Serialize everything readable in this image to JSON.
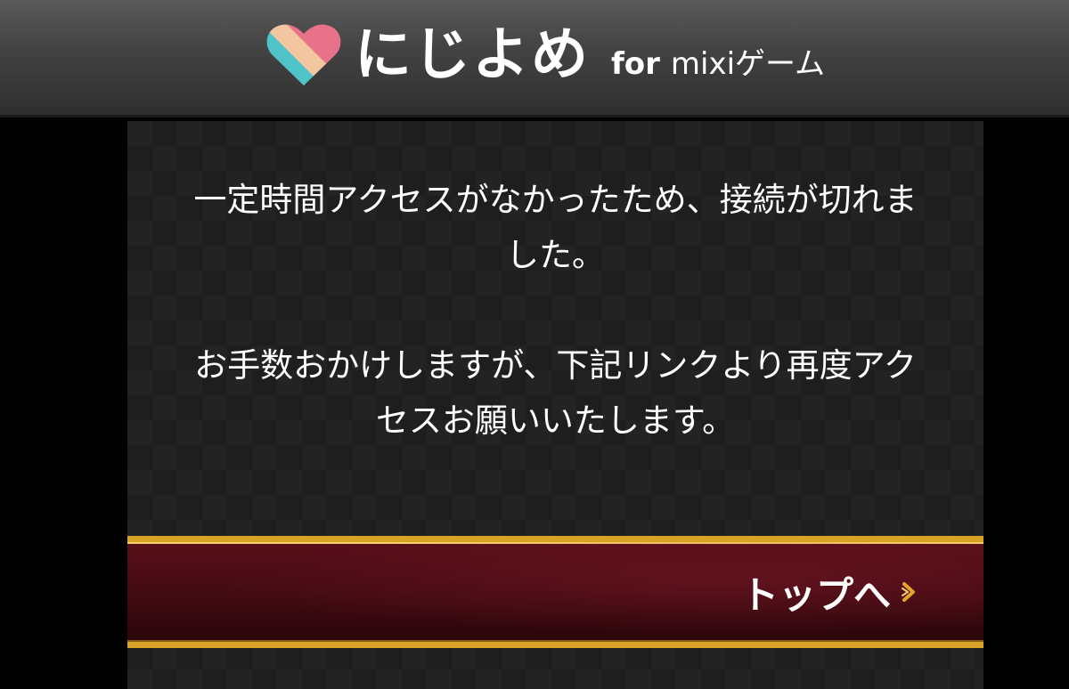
{
  "header": {
    "logo_text": "にじよめ",
    "logo_for": "for",
    "logo_service": "mixiゲーム",
    "icon": "heart-logo-icon",
    "icon_colors": [
      "#8e7cc3",
      "#4fc3c7",
      "#f2c6a0",
      "#e8728a"
    ]
  },
  "message": {
    "line1a": "一定時間アクセスがなかったため、接続が切れま",
    "line1b": "した。",
    "line2a": "お手数おかけしますが、下記リンクより再度アク",
    "line2b": "セスお願いいたします。"
  },
  "link": {
    "top_label": "トップへ",
    "icon": "chevron-right-icon"
  },
  "colors": {
    "gold": "#d9a227",
    "bar": "#4a0c15",
    "background": "#232323"
  }
}
